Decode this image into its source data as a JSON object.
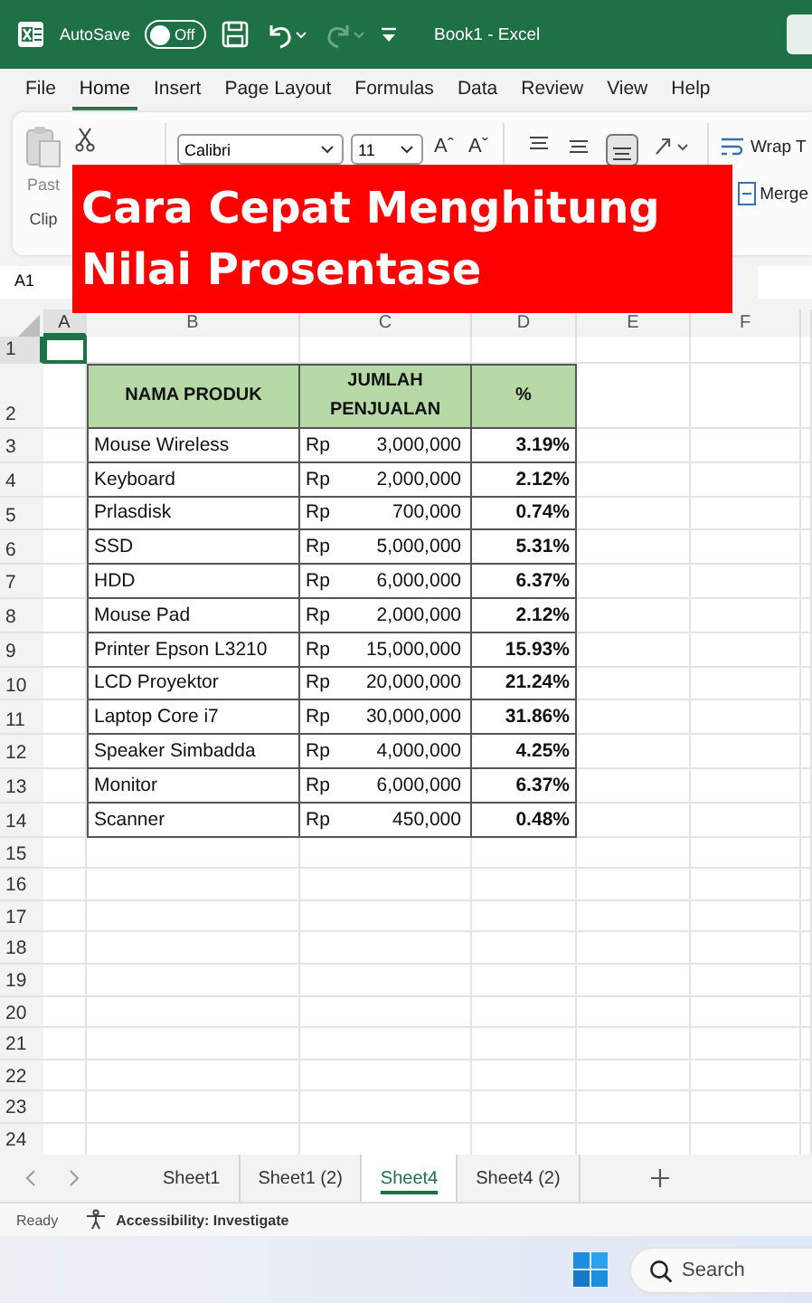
{
  "title_bar": {
    "autosave_label": "AutoSave",
    "autosave": {
      "on": false,
      "label": "Off"
    },
    "document_title": "Book1  -  Excel"
  },
  "menu_tabs": [
    {
      "label": "File",
      "selected": false
    },
    {
      "label": "Home",
      "selected": true
    },
    {
      "label": "Insert",
      "selected": false
    },
    {
      "label": "Page Layout",
      "selected": false
    },
    {
      "label": "Formulas",
      "selected": false
    },
    {
      "label": "Data",
      "selected": false
    },
    {
      "label": "Review",
      "selected": false
    },
    {
      "label": "View",
      "selected": false
    },
    {
      "label": "Help",
      "selected": false
    }
  ],
  "ribbon": {
    "paste_label": "Past",
    "clipboard_label": "Clip",
    "font_name": "Calibri",
    "font_size": "11",
    "font_grow": "Aˆ",
    "font_shrink": "Aˇ",
    "wrap_label": "Wrap T",
    "merge_label": "Merge"
  },
  "banner": {
    "lines": [
      "Cara Cepat Menghitung",
      "Nilai Prosentase"
    ]
  },
  "name_box": "A1",
  "columns": [
    "A",
    "B",
    "C",
    "D",
    "E",
    "F"
  ],
  "row_numbers": [
    "1",
    "2",
    "3",
    "4",
    "5",
    "6",
    "7",
    "8",
    "9",
    "10",
    "11",
    "12",
    "13",
    "14",
    "15",
    "16",
    "17",
    "18",
    "19",
    "20",
    "21",
    "22",
    "23",
    "24"
  ],
  "table_header": {
    "product": "NAMA PRODUK",
    "sales": "JUMLAH PENJUALAN",
    "percent": "%"
  },
  "rows": [
    {
      "product": "Mouse Wireless",
      "currency": "Rp",
      "amount": "3,000,000",
      "percent": "3.19%"
    },
    {
      "product": "Keyboard",
      "currency": "Rp",
      "amount": "2,000,000",
      "percent": "2.12%"
    },
    {
      "product": "Prlasdisk",
      "currency": "Rp",
      "amount": "700,000",
      "percent": "0.74%"
    },
    {
      "product": "SSD",
      "currency": "Rp",
      "amount": "5,000,000",
      "percent": "5.31%"
    },
    {
      "product": "HDD",
      "currency": "Rp",
      "amount": "6,000,000",
      "percent": "6.37%"
    },
    {
      "product": "Mouse Pad",
      "currency": "Rp",
      "amount": "2,000,000",
      "percent": "2.12%"
    },
    {
      "product": "Printer Epson L3210",
      "currency": "Rp",
      "amount": "15,000,000",
      "percent": "15.93%"
    },
    {
      "product": "LCD Proyektor",
      "currency": "Rp",
      "amount": "20,000,000",
      "percent": "21.24%"
    },
    {
      "product": "Laptop Core i7",
      "currency": "Rp",
      "amount": "30,000,000",
      "percent": "31.86%"
    },
    {
      "product": "Speaker Simbadda",
      "currency": "Rp",
      "amount": "4,000,000",
      "percent": "4.25%"
    },
    {
      "product": "Monitor",
      "currency": "Rp",
      "amount": "6,000,000",
      "percent": "6.37%"
    },
    {
      "product": "Scanner",
      "currency": "Rp",
      "amount": "450,000",
      "percent": "0.48%"
    }
  ],
  "sheet_tabs": [
    {
      "label": "Sheet1",
      "selected": false
    },
    {
      "label": "Sheet1 (2)",
      "selected": false
    },
    {
      "label": "Sheet4",
      "selected": true
    },
    {
      "label": "Sheet4 (2)",
      "selected": false
    }
  ],
  "status_bar": {
    "mode": "Ready",
    "accessibility": "Accessibility: Investigate"
  },
  "taskbar": {
    "search_placeholder": "Search"
  }
}
